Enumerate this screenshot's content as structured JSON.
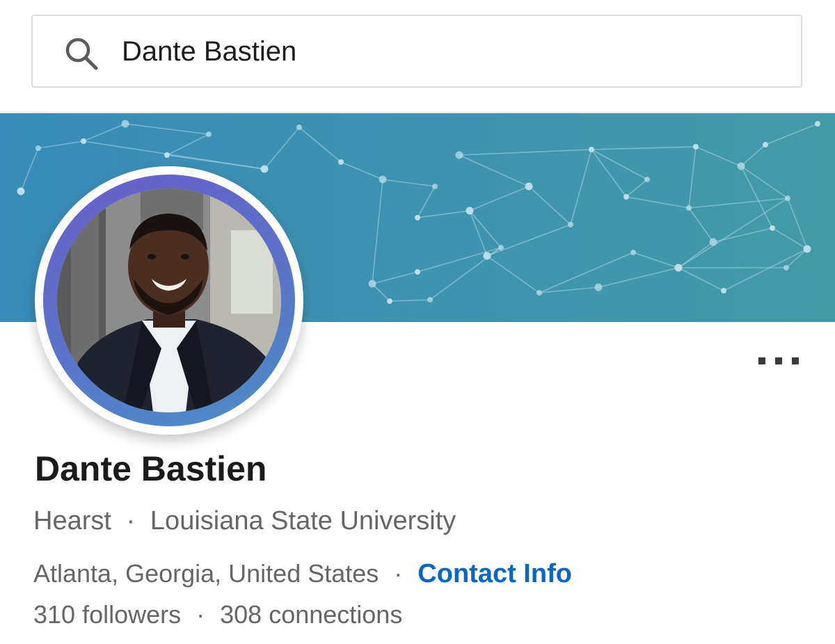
{
  "search": {
    "value": "Dante Bastien",
    "icon": "search-icon"
  },
  "profile": {
    "name": "Dante Bastien",
    "company": "Hearst",
    "school": "Louisiana State University",
    "separator": "·",
    "location": "Atlanta, Georgia, United States",
    "contact_label": "Contact Info",
    "followers": "310 followers",
    "connections": "308 connections",
    "more_icon": "more-horizontal-icon"
  },
  "colors": {
    "banner": "#3c8fb8",
    "link": "#0a66c2",
    "avatar_ring": "#5a74c9"
  }
}
